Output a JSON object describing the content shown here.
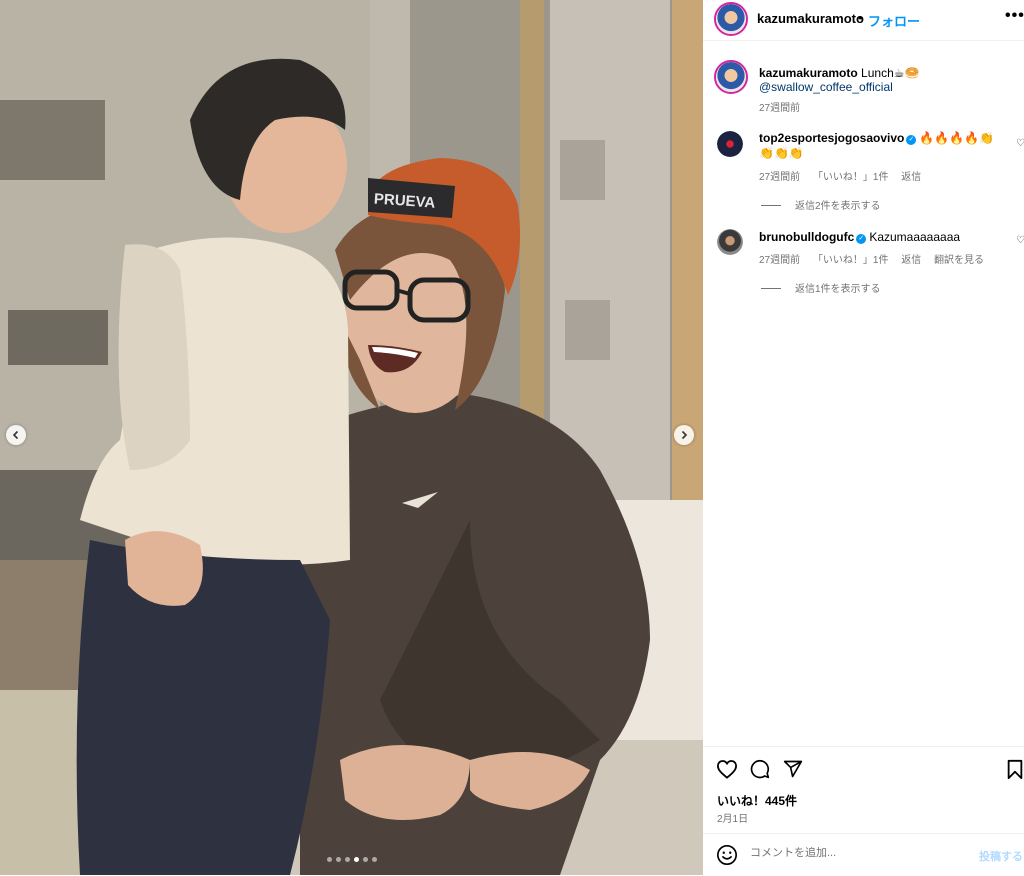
{
  "post": {
    "username": "kazumakuramoto",
    "follow_label": "フォロー",
    "header_separator": "•",
    "more_label": "•••"
  },
  "caption": {
    "username": "kazumakuramoto",
    "text": "Lunch☕🥯",
    "mention": "@swallow_coffee_official",
    "time": "27週間前"
  },
  "comments": [
    {
      "username": "top2esportesjogosaovivo",
      "verified": true,
      "text": "🔥🔥🔥🔥👏👏👏👏",
      "time": "27週間前",
      "likes": "「いいね！」1件",
      "reply": "返信",
      "view_replies": "返信2件を表示する"
    },
    {
      "username": "brunobulldogufc",
      "verified": true,
      "text": "Kazumaaaaaaaa",
      "time": "27週間前",
      "likes": "「いいね！」1件",
      "reply": "返信",
      "translate": "翻訳を見る",
      "view_replies": "返信1件を表示する"
    }
  ],
  "actions": {
    "likes": "いいね！445件",
    "date": "2月1日",
    "icons": [
      "heart-icon",
      "comment-icon",
      "share-icon",
      "bookmark-icon"
    ]
  },
  "comment_box": {
    "placeholder": "コメントを追加...",
    "post_label": "投稿する"
  },
  "carousel": {
    "slide_count": 6,
    "active_index": 3
  },
  "colors": {
    "link": "#0095f6",
    "mention": "#00376b",
    "muted": "#737373",
    "story_ring": "#d6249f"
  }
}
